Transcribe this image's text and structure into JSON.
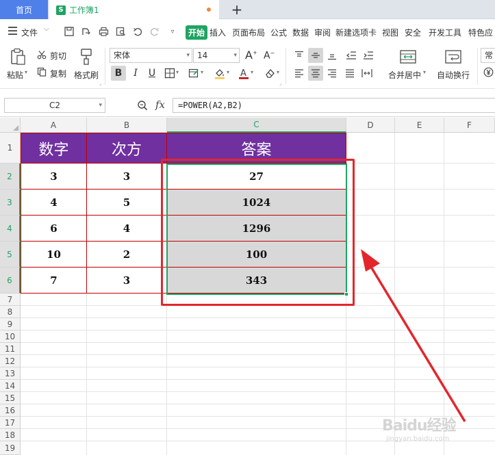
{
  "tabs": {
    "home": "首页",
    "doc_icon": "S",
    "doc": "工作簿1",
    "new_tab": "+"
  },
  "menu": {
    "file": "文件",
    "items": [
      "开始",
      "插入",
      "页面布局",
      "公式",
      "数据",
      "审阅",
      "新建选项卡",
      "视图",
      "安全",
      "开发工具",
      "特色应"
    ]
  },
  "ribbon": {
    "paste": "粘贴",
    "cut": "剪切",
    "copy": "复制",
    "format_painter": "格式刷",
    "font_name": "宋体",
    "font_size": "14",
    "bold": "B",
    "italic": "I",
    "underline": "U",
    "merge_center": "合并居中",
    "wrap": "自动换行",
    "number_format": "常规"
  },
  "formula_bar": {
    "name_box": "C2",
    "fx": "fx",
    "formula": "=POWER(A2,B2)"
  },
  "grid": {
    "columns": [
      "A",
      "B",
      "C",
      "D",
      "E",
      "F"
    ],
    "rows": [
      "1",
      "2",
      "3",
      "4",
      "5",
      "6",
      "7",
      "8",
      "9",
      "10",
      "11",
      "12",
      "13",
      "14",
      "15",
      "16",
      "17",
      "18",
      "19"
    ],
    "headers": [
      "数字",
      "次方",
      "答案"
    ],
    "data": [
      [
        "3",
        "3",
        "27"
      ],
      [
        "4",
        "5",
        "1024"
      ],
      [
        "6",
        "4",
        "1296"
      ],
      [
        "10",
        "2",
        "100"
      ],
      [
        "7",
        "3",
        "343"
      ]
    ]
  },
  "colors": {
    "header_fill": "#7030a0",
    "border_red": "#c00000",
    "selection_green": "#1fa463",
    "annotation_red": "#e3262b"
  },
  "watermark": {
    "logo": "Baidu经验",
    "url": "jingyan.baidu.com"
  }
}
